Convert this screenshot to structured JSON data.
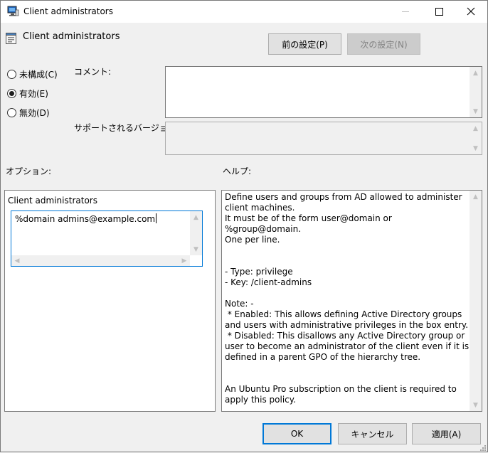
{
  "window": {
    "title": "Client administrators"
  },
  "policy": {
    "name": "Client administrators"
  },
  "nav": {
    "prev_label": "前の設定(P)",
    "next_label": "次の設定(N)"
  },
  "state": {
    "options": [
      {
        "label": "未構成(C)",
        "checked": false
      },
      {
        "label": "有効(E)",
        "checked": true
      },
      {
        "label": "無効(D)",
        "checked": false
      }
    ]
  },
  "labels": {
    "comment": "コメント:",
    "supported": "サポートされるバージョン:",
    "options": "オプション:",
    "help": "ヘルプ:"
  },
  "comment_value": "",
  "supported_value": "",
  "option_panel": {
    "title": "Client administrators",
    "value": "%domain admins@example.com"
  },
  "help_text": "Define users and groups from AD allowed to administer\nclient machines.\nIt must be of the form user@domain or %group@domain.\nOne per line.\n\n\n- Type: privilege\n- Key: /client-admins\n\nNote: -\n * Enabled: This allows defining Active Directory groups\nand users with administrative privileges in the box entry.\n * Disabled: This disallows any Active Directory group or\nuser to become an administrator of the client even if it is\ndefined in a parent GPO of the hierarchy tree.\n\n\nAn Ubuntu Pro subscription on the client is required to\napply this policy.",
  "buttons": {
    "ok": "OK",
    "cancel": "キャンセル",
    "apply": "適用(A)"
  },
  "colors": {
    "focus": "#0078d7",
    "window_bg": "#f0f0f0"
  }
}
